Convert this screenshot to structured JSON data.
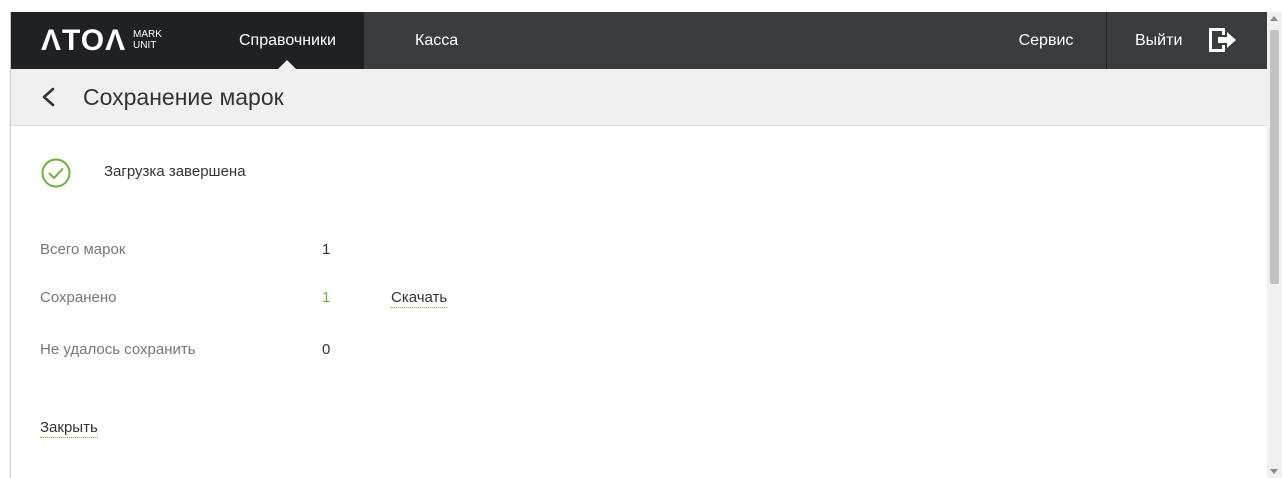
{
  "navbar": {
    "logo_main": "ΛTOΛ",
    "logo_sub_1": "MARK",
    "logo_sub_2": "UNIT",
    "items": [
      {
        "label": "Справочники",
        "active": true
      },
      {
        "label": "Касса",
        "active": false
      }
    ],
    "service_label": "Сервис",
    "logout_label": "Выйти"
  },
  "subheader": {
    "title": "Сохранение марок"
  },
  "status": {
    "text": "Загрузка завершена",
    "icon": "check-circle-icon"
  },
  "summary": {
    "total_label": "Всего марок",
    "total_value": "1",
    "saved_label": "Сохранено",
    "saved_value": "1",
    "download_label": "Скачать",
    "failed_label": "Не удалось сохранить",
    "failed_value": "0"
  },
  "actions": {
    "close_label": "Закрыть"
  },
  "colors": {
    "navbar_bg": "#3a3d40",
    "navbar_active_bg": "#1f2124",
    "accent_green": "#6cb13b",
    "subheader_bg": "#f0f0f0"
  }
}
